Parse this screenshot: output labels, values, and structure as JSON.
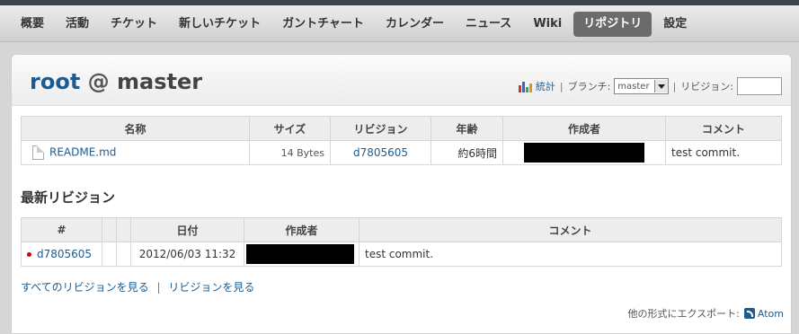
{
  "menu": {
    "items": [
      {
        "label": "概要"
      },
      {
        "label": "活動"
      },
      {
        "label": "チケット"
      },
      {
        "label": "新しいチケット"
      },
      {
        "label": "ガントチャート"
      },
      {
        "label": "カレンダー"
      },
      {
        "label": "ニュース"
      },
      {
        "label": "Wiki"
      },
      {
        "label": "リポジトリ",
        "selected": true
      },
      {
        "label": "設定"
      }
    ]
  },
  "repo": {
    "root": "root",
    "at": "@",
    "branch": "master"
  },
  "contextual": {
    "stats_label": "統計",
    "separator": "|",
    "branch_label": "ブランチ:",
    "branch_value": "master",
    "revision_label": "リビジョン:",
    "revision_value": ""
  },
  "entries": {
    "headers": [
      "名称",
      "サイズ",
      "リビジョン",
      "年齢",
      "作成者",
      "コメント"
    ],
    "rows": [
      {
        "name": "README.md",
        "size": "14 Bytes",
        "revision": "d7805605",
        "age": "約6時間",
        "author": "",
        "comment": "test commit."
      }
    ]
  },
  "latest": {
    "title": "最新リビジョン",
    "headers": [
      "#",
      "",
      "",
      "日付",
      "作成者",
      "コメント"
    ],
    "rows": [
      {
        "revision": "d7805605",
        "date": "2012/06/03 11:32",
        "author": "",
        "comment": "test commit."
      }
    ]
  },
  "links": {
    "all_revisions": "すべてのリビジョンを見る",
    "separator": "|",
    "view_revisions": "リビジョンを見る"
  },
  "export": {
    "label": "他の形式にエクスポート:",
    "atom": "Atom"
  },
  "colors": {
    "link": "#1f5b8c",
    "selected_tab": "#6b6b6b",
    "redaction": "#000000",
    "dot": "#cc0000"
  }
}
